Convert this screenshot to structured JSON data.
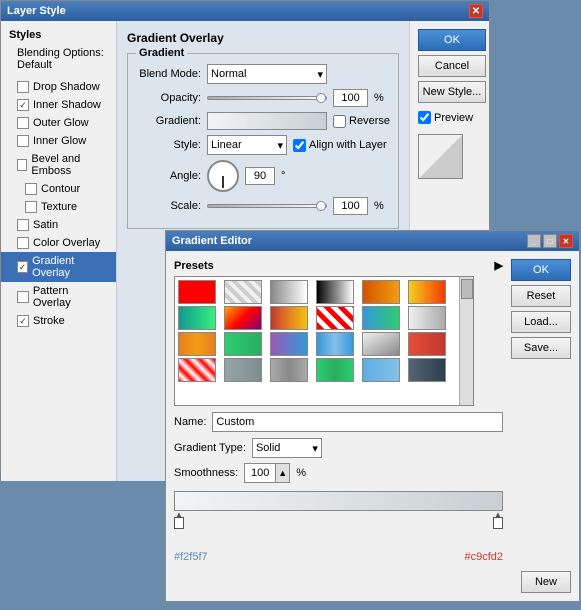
{
  "layerStyle": {
    "title": "Layer Style",
    "sidebar": {
      "styles_title": "Styles",
      "blending_title": "Blending Options: Default",
      "items": [
        {
          "label": "Drop Shadow",
          "checked": false,
          "id": "drop-shadow"
        },
        {
          "label": "Inner Shadow",
          "checked": true,
          "id": "inner-shadow"
        },
        {
          "label": "Outer Glow",
          "checked": false,
          "id": "outer-glow"
        },
        {
          "label": "Inner Glow",
          "checked": false,
          "id": "inner-glow"
        },
        {
          "label": "Bevel and Emboss",
          "checked": false,
          "id": "bevel-emboss"
        },
        {
          "label": "Contour",
          "checked": false,
          "id": "contour",
          "sub": true
        },
        {
          "label": "Texture",
          "checked": false,
          "id": "texture",
          "sub": true
        },
        {
          "label": "Satin",
          "checked": false,
          "id": "satin"
        },
        {
          "label": "Color Overlay",
          "checked": false,
          "id": "color-overlay"
        },
        {
          "label": "Gradient Overlay",
          "checked": true,
          "id": "gradient-overlay",
          "active": true
        },
        {
          "label": "Pattern Overlay",
          "checked": false,
          "id": "pattern-overlay"
        },
        {
          "label": "Stroke",
          "checked": true,
          "id": "stroke"
        }
      ]
    },
    "gradientOverlay": {
      "section_title": "Gradient Overlay",
      "gradient_group_title": "Gradient",
      "blend_mode_label": "Blend Mode:",
      "blend_mode_value": "Normal",
      "opacity_label": "Opacity:",
      "opacity_value": "100",
      "percent": "%",
      "gradient_label": "Gradient:",
      "reverse_label": "Reverse",
      "style_label": "Style:",
      "style_value": "Linear",
      "align_layer_label": "Align with Layer",
      "angle_label": "Angle:",
      "angle_value": "90",
      "degree_symbol": "°",
      "scale_label": "Scale:",
      "scale_value": "100"
    },
    "buttons": {
      "ok": "OK",
      "cancel": "Cancel",
      "new_style": "New Style...",
      "preview_label": "Preview"
    }
  },
  "gradientEditor": {
    "title": "Gradient Editor",
    "presets_title": "Presets",
    "name_label": "Name:",
    "name_value": "Custom",
    "new_button": "New",
    "gradient_type_label": "Gradient Type:",
    "gradient_type_value": "Solid",
    "smoothness_label": "Smoothness:",
    "smoothness_value": "100",
    "percent": "%",
    "color_left": "#f2f5f7",
    "color_right": "#c9cfd2",
    "buttons": {
      "ok": "OK",
      "reset": "Reset",
      "load": "Load...",
      "save": "Save..."
    },
    "swatches": [
      {
        "bg": "linear-gradient(to right, red, red)"
      },
      {
        "bg": "repeating-linear-gradient(45deg, #f0f0f0, #f0f0f0 4px, #ccc 4px, #ccc 8px)"
      },
      {
        "bg": "linear-gradient(to right, #888, #fff)"
      },
      {
        "bg": "linear-gradient(to right, #000, #fff)"
      },
      {
        "bg": "linear-gradient(to right, #d35400, #f39c12)"
      },
      {
        "bg": "linear-gradient(to right, #f5d020, #f53803)"
      },
      {
        "bg": "linear-gradient(to right, #11998e, #38ef7d)"
      },
      {
        "bg": "linear-gradient(135deg, orange, red, purple)"
      },
      {
        "bg": "linear-gradient(to right, #c0392b, #e67e22, #f1c40f)"
      },
      {
        "bg": "repeating-linear-gradient(45deg, red, red 5px, white 5px, white 10px)"
      },
      {
        "bg": "linear-gradient(to right, #3498db, #2ecc71)"
      },
      {
        "bg": "linear-gradient(to right, #f0f0f0, #aaa)"
      },
      {
        "bg": "linear-gradient(to right, #e67e22, #f39c12, #e67e22)"
      },
      {
        "bg": "linear-gradient(to right, #2ecc71, #27ae60)"
      },
      {
        "bg": "linear-gradient(to right, #9b59b6, #3498db)"
      },
      {
        "bg": "linear-gradient(to right, #3498db, #85c1e9, #3498db)"
      },
      {
        "bg": "linear-gradient(to bottom right, #f0f0f0, #888)"
      },
      {
        "bg": "linear-gradient(to right, #e74c3c, #c0392b)"
      },
      {
        "bg": "repeating-linear-gradient(45deg, red, white 5px, red 10px)"
      },
      {
        "bg": "linear-gradient(to right, #95a5a6, #7f8c8d)"
      },
      {
        "bg": "linear-gradient(to right, #aaa, #888, #aaa)"
      },
      {
        "bg": "linear-gradient(to right, #2ecc71, #27ae60, #2ecc71)"
      },
      {
        "bg": "linear-gradient(to right, #5dade2, #85c1e9)"
      },
      {
        "bg": "linear-gradient(to right, #566573, #2c3e50)"
      }
    ]
  }
}
